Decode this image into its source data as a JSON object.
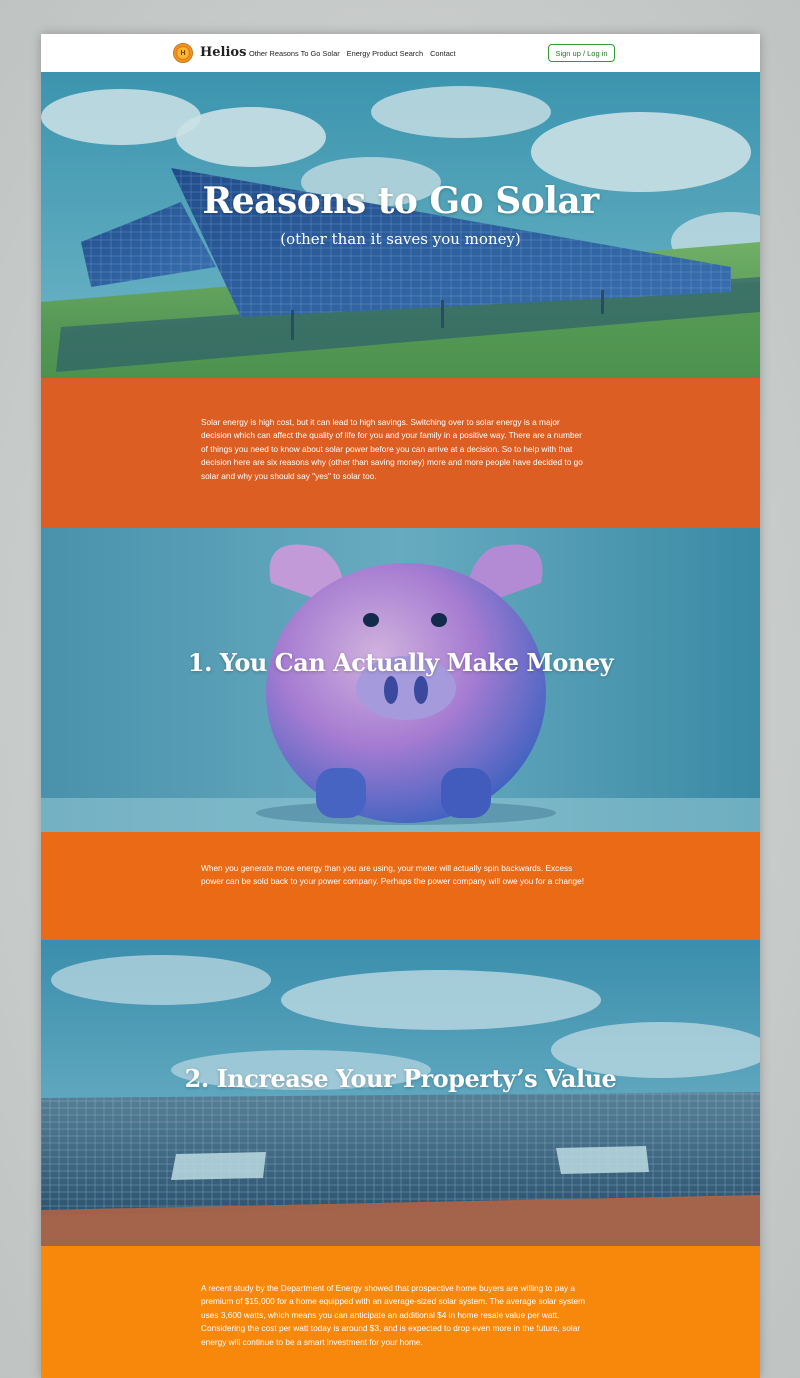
{
  "nav": {
    "logo_letter": "H",
    "brand": "Helios",
    "links": [
      "Other Reasons To Go Solar",
      "Energy Product Search",
      "Contact"
    ],
    "signup": "Sign up / Log in"
  },
  "hero": {
    "title": "Reasons to Go Solar",
    "subtitle": "(other than it saves you money)"
  },
  "intro": {
    "text": "Solar energy is high cost, but it can lead to high savings. Switching over to solar energy is a major decision which can affect the quality of life for you and your family in a positive way. There are a number of things you need to know about solar power before you can arrive at a decision. So to help with that decision here are six reasons why (other than saving money) more and more people have decided to go solar and why you should say \"yes\" to solar too."
  },
  "reasons": [
    {
      "title": "1. You Can Actually Make Money",
      "text": "When you generate more energy than you are using, your meter will actually spin backwards. Excess power can be sold back to your power company. Perhaps the power company will owe you for a change!"
    },
    {
      "title": "2. Increase Your Property’s Value",
      "text": "A recent study by the Department of Energy showed that prospective home buyers are willing to pay a premium of $15,000 for a home equipped with an average-sized solar system. The average solar system uses 3,600 watts, which means you can anticipate an additional $4 in home resale value per watt. Considering the cost per watt today is around $3, and is expected to drop even more in the future, solar energy will continue to be a smart investment for your home."
    }
  ],
  "colors": {
    "orange_dark": "#dc5e22",
    "orange_mid": "#ea6a16",
    "orange_light": "#f7880c",
    "teal": "#3f8fa3",
    "button_green": "#2e9d2e"
  },
  "icons": [
    "helios-logo-icon"
  ]
}
